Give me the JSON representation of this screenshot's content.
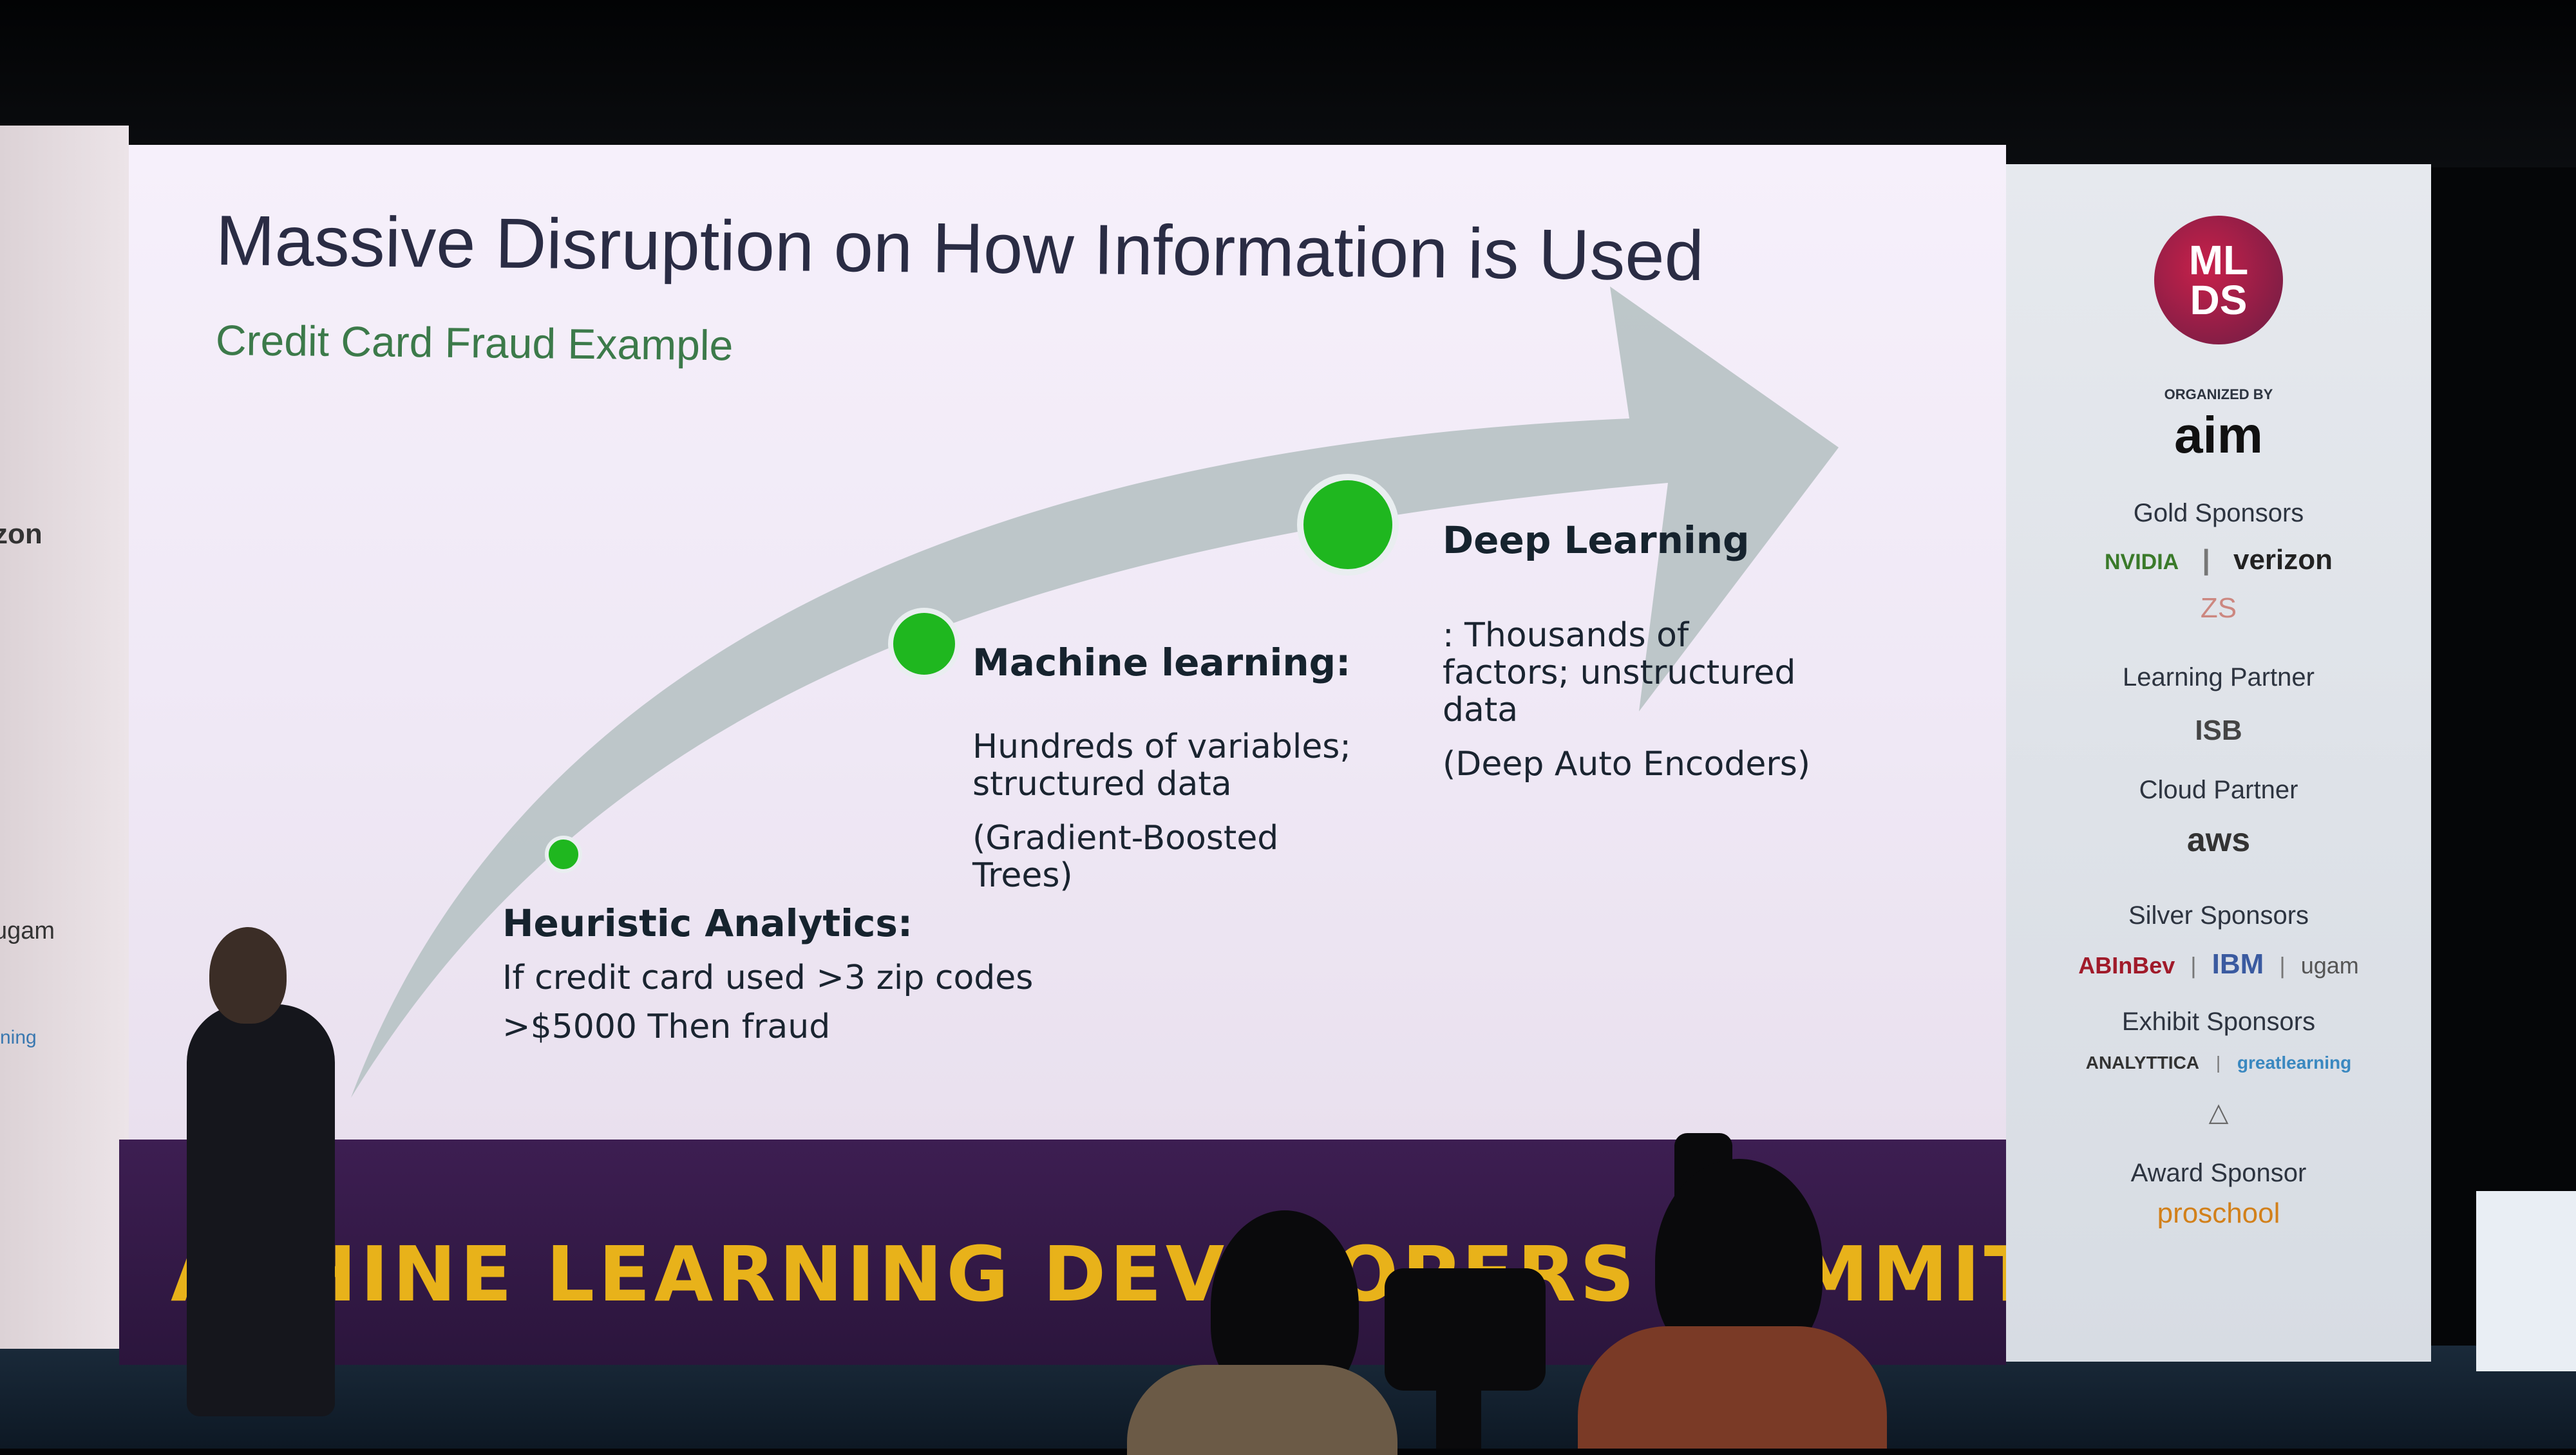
{
  "slide": {
    "title": "Massive Disruption on How Information is Used",
    "subtitle": "Credit Card Fraud Example",
    "stages": [
      {
        "label": "Heuristic Analytics:",
        "lines": [
          "If credit card used >3 zip codes",
          ">$5000  Then fraud"
        ]
      },
      {
        "label": "Machine learning:",
        "lines": [
          "Hundreds of variables;",
          "structured data",
          "(Gradient-Boosted",
          "Trees)"
        ]
      },
      {
        "label": "Deep Learning",
        "lines": [
          ": Thousands of",
          "factors; unstructured",
          "data",
          "(Deep Auto Encoders)"
        ]
      }
    ],
    "colors": {
      "arrow": "#b9c4c6",
      "dot": "#1fb71f",
      "title": "#2a2c44",
      "subtitle": "#3c7a4a"
    }
  },
  "banner": {
    "text": "ACHINE LEARNING DEVELOPERS SUMMIT"
  },
  "left_panel": {
    "texts": [
      "zon",
      "ugam",
      "rning"
    ]
  },
  "sponsor_panel": {
    "logo": {
      "line1": "ML",
      "line2": "DS"
    },
    "organized_by": "ORGANIZED BY",
    "organizer": "aim",
    "sections": [
      {
        "heading": "Gold Sponsors",
        "logos": [
          "NVIDIA",
          "|",
          "verizon",
          "ZS"
        ]
      },
      {
        "heading": "Learning Partner",
        "logos": [
          "ISB"
        ]
      },
      {
        "heading": "Cloud Partner",
        "logos": [
          "aws"
        ]
      },
      {
        "heading": "Silver Sponsors",
        "logos": [
          "ABInBev",
          "|",
          "IBM",
          "|",
          "ugam"
        ]
      },
      {
        "heading": "Exhibit Sponsors",
        "logos": [
          "ANALYTTICA",
          "|",
          "greatlearning"
        ]
      },
      {
        "heading": "Award Sponsor",
        "logos": [
          "proschool"
        ]
      }
    ]
  }
}
